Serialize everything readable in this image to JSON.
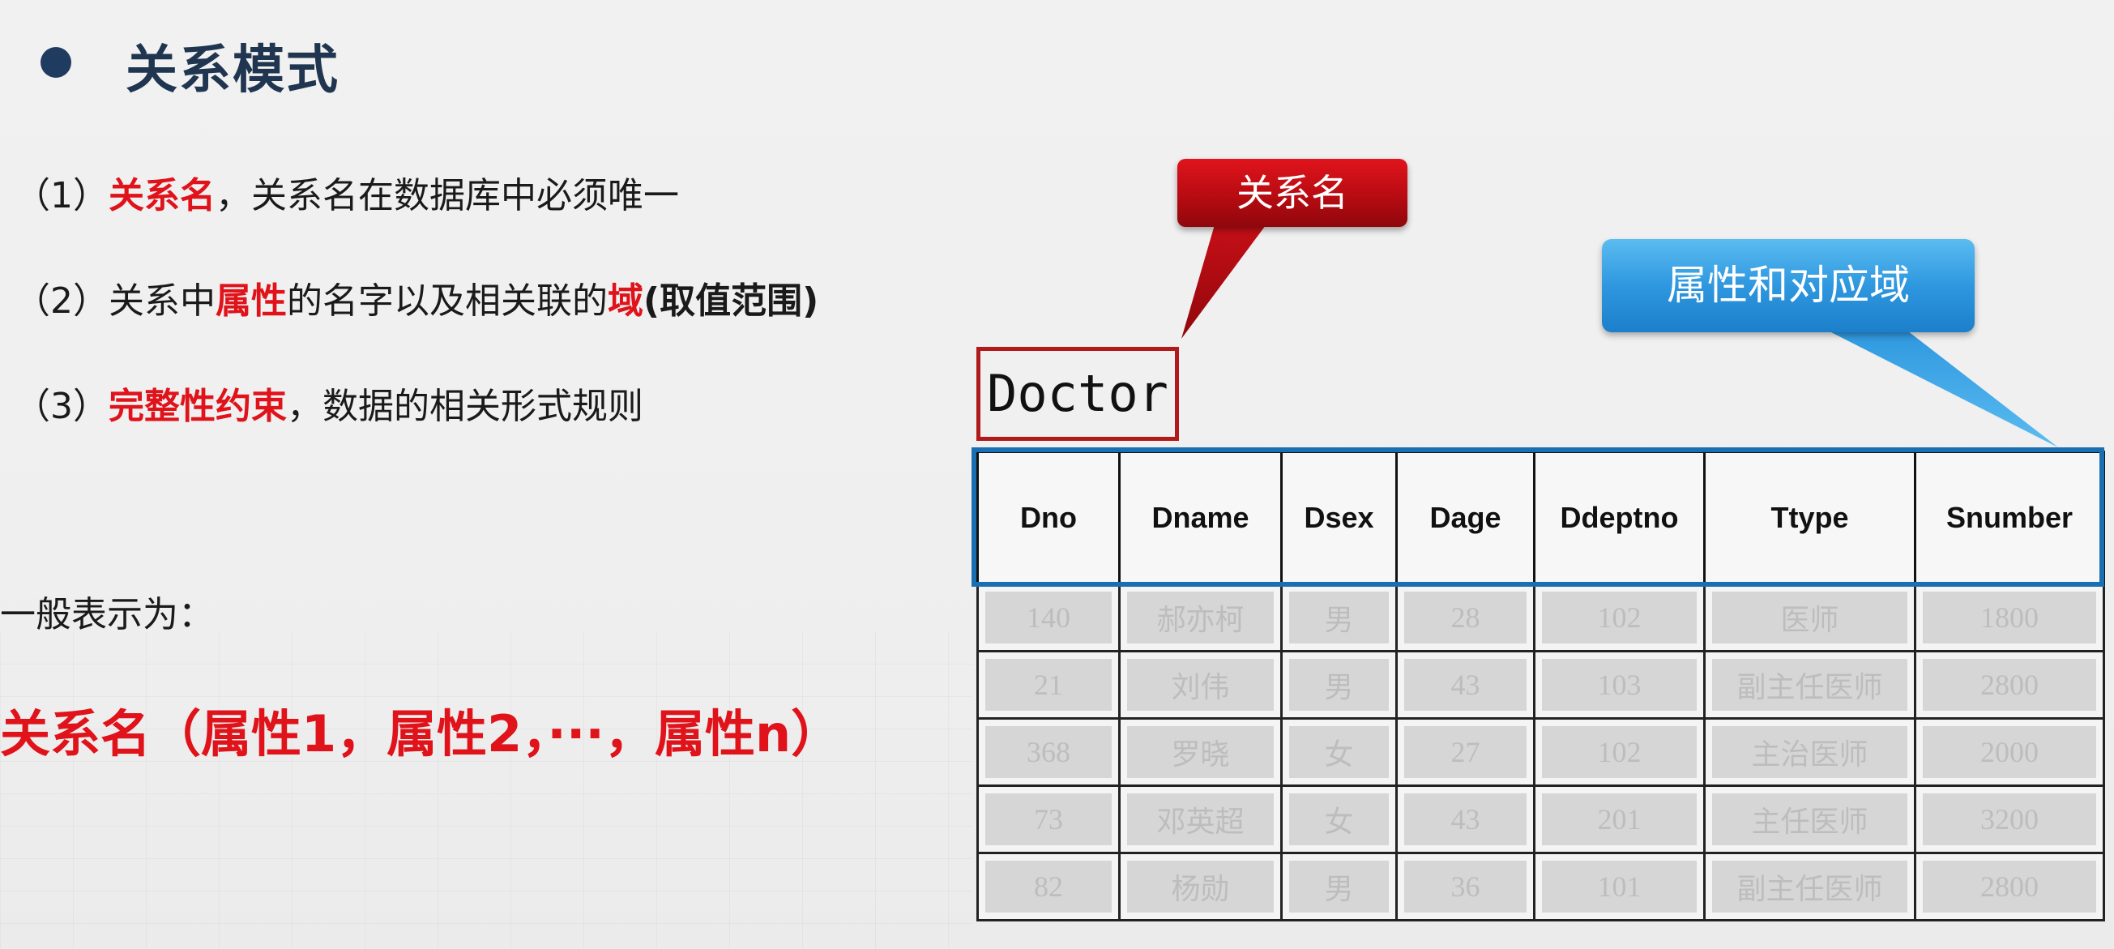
{
  "section_title": "关系模式",
  "items": [
    {
      "num": "（1）",
      "parts": [
        {
          "text": "关系名",
          "style": "hl"
        },
        {
          "text": "，关系名在数据库中必须唯一",
          "style": "normal"
        }
      ]
    },
    {
      "num": "（2）",
      "parts": [
        {
          "text": "关系中",
          "style": "normal"
        },
        {
          "text": "属性",
          "style": "hl"
        },
        {
          "text": "的名字以及相关联的",
          "style": "normal"
        },
        {
          "text": "域",
          "style": "hl"
        },
        {
          "text": "(取值范围)",
          "style": "bold"
        }
      ]
    },
    {
      "num": "（3）",
      "parts": [
        {
          "text": "完整性约束",
          "style": "hl"
        },
        {
          "text": "，数据的相关形式规则",
          "style": "normal"
        }
      ]
    }
  ],
  "general_label": "一般表示为：",
  "general_formula": "关系名（属性1，属性2，···，属性n）",
  "callouts": {
    "relation_name": "关系名",
    "attributes_domain": "属性和对应域"
  },
  "table_name": "Doctor",
  "table": {
    "columns": [
      "Dno",
      "Dname",
      "Dsex",
      "Dage",
      "Ddeptno",
      "Ttype",
      "Snumber"
    ],
    "rows": [
      [
        "140",
        "郝亦柯",
        "男",
        "28",
        "102",
        "医师",
        "1800"
      ],
      [
        "21",
        "刘伟",
        "男",
        "43",
        "103",
        "副主任医师",
        "2800"
      ],
      [
        "368",
        "罗晓",
        "女",
        "27",
        "102",
        "主治医师",
        "2000"
      ],
      [
        "73",
        "邓英超",
        "女",
        "43",
        "201",
        "主任医师",
        "3200"
      ],
      [
        "82",
        "杨勋",
        "男",
        "36",
        "101",
        "副主任医师",
        "2800"
      ]
    ]
  },
  "colors": {
    "accent_red": "#e0121a",
    "title_navy": "#20354f",
    "callout_blue": "#2e97df",
    "header_outline_blue": "#1a6fb3"
  }
}
